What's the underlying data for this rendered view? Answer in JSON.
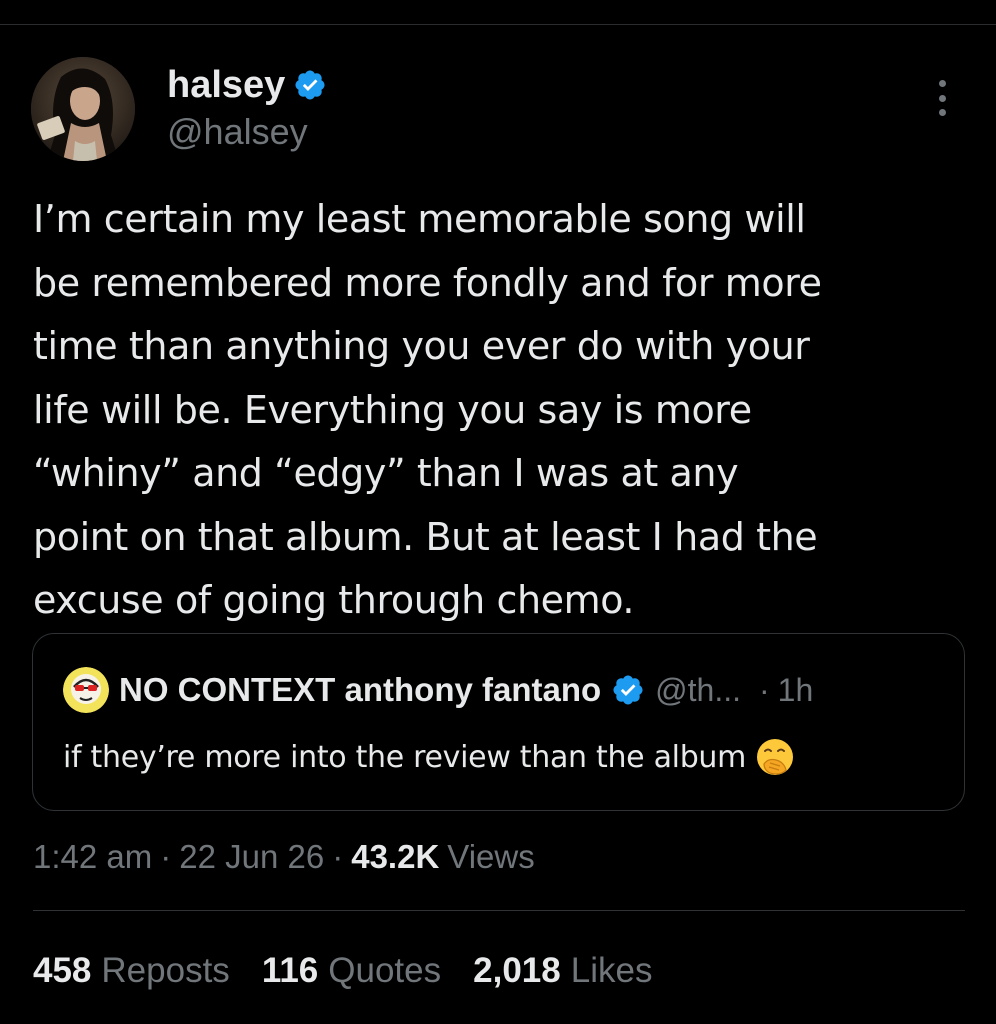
{
  "tweet": {
    "author": {
      "display_name": "halsey",
      "handle": "@halsey",
      "verified": true,
      "avatar_icon": "profile-photo"
    },
    "text": "I’m certain my least memorable song will\nbe remembered more fondly and for more\ntime than anything you ever do with your\nlife will be. Everything you say is more\n“whiny” and “edgy” than I was at any\npoint on that album. But at least I had the\nexcuse of going through chemo.",
    "quoted_tweet": {
      "author_name": "NO CONTEXT anthony fantano",
      "author_handle": "@th...",
      "separator": "·",
      "time": "1h",
      "text": "if they’re more into the review than the album",
      "emoji_icon": "face-with-hand-over-mouth-emoji"
    },
    "meta": {
      "time": "1:42 am",
      "separator": "·",
      "date": "22 Jun 26",
      "views_count": "43.2K",
      "views_label": "Views"
    },
    "stats": {
      "reposts_count": "458",
      "reposts_label": "Reposts",
      "quotes_count": "116",
      "quotes_label": "Quotes",
      "likes_count": "2,018",
      "likes_label": "Likes"
    }
  },
  "colors": {
    "background": "#000000",
    "text_primary": "#e7e9ea",
    "text_secondary": "#71767b",
    "verified_badge": "#1d9bf0",
    "border": "#2f3336"
  }
}
